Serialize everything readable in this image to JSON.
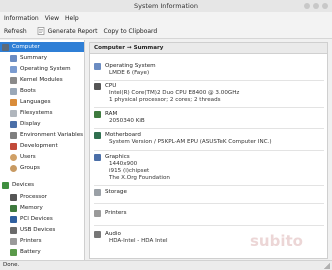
{
  "window": {
    "title": "System Information"
  },
  "menu": [
    "Information",
    "View",
    "Help"
  ],
  "toolbar": {
    "refresh": "Refresh",
    "report": "Generate Report",
    "clipboard": "Copy to Clipboard"
  },
  "sidebar": {
    "computer": "Computer",
    "computer_items": [
      "Summary",
      "Operating System",
      "Kernel Modules",
      "Boots",
      "Languages",
      "Filesystems",
      "Display",
      "Environment Variables",
      "Development",
      "Users",
      "Groups"
    ],
    "devices": "Devices",
    "device_items": [
      "Processor",
      "Memory",
      "PCI Devices",
      "USB Devices",
      "Printers",
      "Battery"
    ]
  },
  "content": {
    "heading": "Computer → Summary",
    "os": {
      "title": "Operating System",
      "values": [
        "LMDE 6 (Faye)"
      ]
    },
    "cpu": {
      "title": "CPU",
      "values": [
        "Intel(R) Core(TM)2 Duo CPU     E8400  @ 3.00GHz",
        "1 physical processor; 2 cores; 2 threads"
      ]
    },
    "ram": {
      "title": "RAM",
      "values": [
        "2050340 KiB"
      ]
    },
    "motherboard": {
      "title": "Motherboard",
      "values": [
        "System Version / P5KPL-AM EPU (ASUSTeK Computer INC.)"
      ]
    },
    "graphics": {
      "title": "Graphics",
      "values": [
        "1440x900",
        "i915 (i)chipset",
        "The X.Org Foundation"
      ]
    },
    "storage": {
      "title": "Storage",
      "values": []
    },
    "printers": {
      "title": "Printers",
      "values": []
    },
    "audio": {
      "title": "Audio",
      "values": [
        "HDA-Intel - HDA Intel"
      ]
    }
  },
  "status": "Done.",
  "watermark": "subito"
}
